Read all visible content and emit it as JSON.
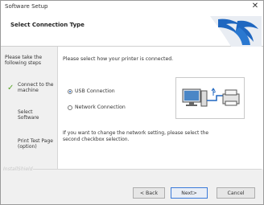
{
  "window": {
    "title": "Software Setup",
    "close_glyph": "✕"
  },
  "header": {
    "title": "Select Connection Type",
    "logo_icon": "brand-wave-logo-icon"
  },
  "sidebar": {
    "heading": "Please take the following steps",
    "steps": [
      {
        "label": "Connect to the machine",
        "completed": true
      },
      {
        "label": "Select Software",
        "completed": false
      },
      {
        "label": "Print Test Page (option)",
        "completed": false
      }
    ],
    "check_glyph": "✓"
  },
  "main": {
    "prompt": "Please select how your printer is connected.",
    "options": [
      {
        "label": "USB Connection",
        "selected": true
      },
      {
        "label": "Network Connection",
        "selected": false
      }
    ],
    "illustration_icon": "pc-usb-printer-icon",
    "note": "If you want to change the network setting, please select the second checkbox selection."
  },
  "footer": {
    "brand": "InstallShield",
    "back_label": "< Back",
    "next_label": "Next>",
    "cancel_label": "Cancel"
  },
  "colors": {
    "accent": "#1c5fbf",
    "check": "#5aa62a",
    "logo_blue": "#1f67c0"
  }
}
